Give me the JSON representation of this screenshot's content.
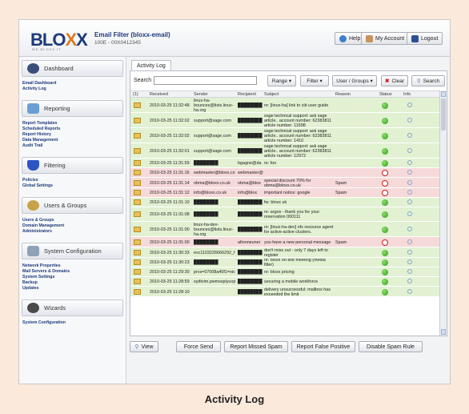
{
  "header": {
    "logo_text": "BLOXX",
    "logo_sub": "WE BLOXX IT",
    "app_title": "Email Filter (bloxx-email)",
    "app_sub": "100E - 00X0412345",
    "help_label": "Help",
    "account_label": "My Account",
    "logout_label": "Logout"
  },
  "sidebar": {
    "sections": [
      {
        "label": "Dashboard",
        "color": "#3a4f7a",
        "links": [
          "Email Dashboard",
          "Activity Log"
        ]
      },
      {
        "label": "Reporting",
        "color": "#6a9fd6",
        "links": [
          "Report Templates",
          "Scheduled Reports",
          "Report History",
          "Data Management",
          "Audit Trail"
        ]
      },
      {
        "label": "Filtering",
        "color": "#2b55c2",
        "links": [
          "Policies",
          "Global Settings"
        ]
      },
      {
        "label": "Users & Groups",
        "color": "#c8a24a",
        "links": [
          "Users & Groups",
          "Domain Management",
          "Administrators"
        ]
      },
      {
        "label": "System Configuration",
        "color": "#8ea2b8",
        "links": [
          "Network Properties",
          "Mail Servers & Domains",
          "System Settings",
          "Backup",
          "Updates"
        ]
      },
      {
        "label": "Wizards",
        "color": "#4a4a4a",
        "links": [
          "System Configuration"
        ]
      }
    ]
  },
  "tab": {
    "label": "Activity Log"
  },
  "toolbar": {
    "search_label": "Search",
    "search_value": "",
    "range_label": "Range ▾",
    "filter_label": "Filter ▾",
    "user_groups_label": "User / Groups ▾",
    "clear_label": "Clear",
    "search_button": "Search"
  },
  "table": {
    "columns": [
      "(1)",
      "Received",
      "Sender",
      "Recipient",
      "Subject",
      "Reason",
      "Status",
      "Info"
    ],
    "rows": [
      {
        "received": "2010-03-25 11:32:48",
        "sender": "linux-ha-bounces@lists.linux-ha.org",
        "recipient": "████████",
        "subject": "re: [linux-ha] link to cib user guide",
        "reason": "",
        "status": "ok"
      },
      {
        "received": "2010-03-25 11:32:02",
        "sender": "support@sage.com",
        "recipient": "████████",
        "subject": "sage technical support: ask sage article.. account number: 62383811 article number: 11698",
        "reason": "",
        "status": "ok"
      },
      {
        "received": "2010-03-25 11:32:02",
        "sender": "support@sage.com",
        "recipient": "████████",
        "subject": "sage technical support: ask sage article.. account number: 62383811 article number: 1410",
        "reason": "",
        "status": "ok"
      },
      {
        "received": "2010-03-25 11:32:01",
        "sender": "support@sage.com",
        "recipient": "████████",
        "subject": "sage technical support: ask sage article.. account number: 62383811 article number: 12972",
        "reason": "",
        "status": "ok"
      },
      {
        "received": "2010-03-25 11:31:59",
        "sender": "████████",
        "recipient": "bgagne@da",
        "subject": "re: foo",
        "reason": "",
        "status": "ok"
      },
      {
        "received": "2010-03-25 11:31:16",
        "sender": "webmaster@bloxx.co",
        "recipient": "webmaster@",
        "subject": "",
        "reason": "",
        "status": "bad"
      },
      {
        "received": "2010-03-25 11:31:14",
        "sender": "obma@bloxx.co.uk",
        "recipient": "obma@blox",
        "subject": "special discount 70% for obma@bloxx.co.uk",
        "reason": "Spam",
        "status": "bad"
      },
      {
        "received": "2010-03-25 11:31:12",
        "sender": "info@bloxx.co.uk",
        "recipient": "info@blox",
        "subject": "important notice: google",
        "reason": "Spam",
        "status": "bad"
      },
      {
        "received": "2010-03-25 11:31:10",
        "sender": "████████",
        "recipient": "████████",
        "subject": "fw: bloxx uk",
        "reason": "",
        "status": "ok"
      },
      {
        "received": "2010-03-25 11:31:08",
        "sender": "████████",
        "recipient": "████████",
        "subject": "re: argos - thank you for your reservation 000111",
        "reason": "",
        "status": "ok"
      },
      {
        "received": "2010-03-25 11:31:00",
        "sender": "linux-ha-dev-bounces@lists.linux-ha.org",
        "recipient": "████████",
        "subject": "re: [linux-ha-dev] nfs resource agent for active-active clusters.",
        "reason": "",
        "status": "ok"
      },
      {
        "received": "2010-03-25 11:31:00",
        "sender": "████████",
        "recipient": "altonneuner",
        "subject": "you have a new personal message",
        "reason": "Spam",
        "status": "bad"
      },
      {
        "received": "2010-03-25 11:30:33",
        "sender": "exc1103226666292_f",
        "recipient": "████████",
        "subject": "don't miss out - only 7 days left to register",
        "reason": "",
        "status": "ok"
      },
      {
        "received": "2010-03-25 11:30:23",
        "sender": "████████",
        "recipient": "████████",
        "subject": "re: bloxx on-line meeting (media filter)",
        "reason": "",
        "status": "ok"
      },
      {
        "received": "2010-03-25 11:29:30",
        "sender": "prvs=07008a40f1=nic",
        "recipient": "████████",
        "subject": "re: bloxx pricing",
        "reason": "",
        "status": "ok"
      },
      {
        "received": "2010-03-25 11:28:59",
        "sender": "sydtvim.pwmssplyuop",
        "recipient": "████████",
        "subject": "securing a mobile workforce",
        "reason": "",
        "status": "ok"
      },
      {
        "received": "2010-03-25 11:28:10",
        "sender": "",
        "recipient": "████████",
        "subject": "delivery unsuccessful: mailbox has exceeded the limit",
        "reason": "",
        "status": "ok"
      }
    ]
  },
  "bottom": {
    "view_label": "View",
    "force_send_label": "Force Send",
    "report_missed_label": "Report Missed Spam",
    "report_false_label": "Report False Positive",
    "disable_rule_label": "Disable Spam Rule"
  },
  "caption": "Activity Log"
}
